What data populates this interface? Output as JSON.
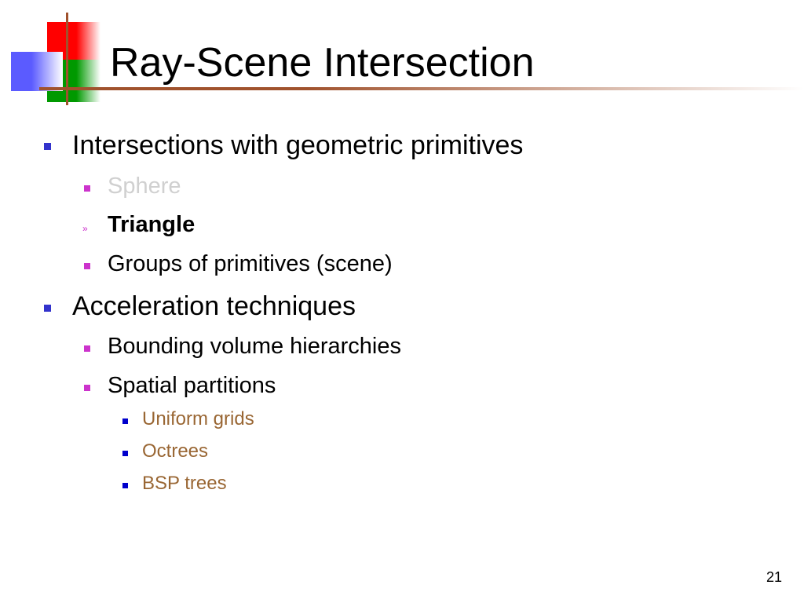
{
  "colors": {
    "red": "#ff0000",
    "green": "#009900",
    "blue": "#5b5bff",
    "rule": "#a0522d",
    "level1_bullet": "#3333cc",
    "level2_bullet": "#cc33cc",
    "level3_bullet": "#0000cc",
    "level3_text": "#996633",
    "dimmed_text": "#d0d0d0"
  },
  "slide": {
    "title": "Ray-Scene Intersection",
    "page_number": "21",
    "items": [
      {
        "level": 1,
        "text": "Intersections with geometric primitives",
        "bullet": "square"
      },
      {
        "level": 2,
        "text": "Sphere",
        "bullet": "square",
        "state": "dimmed"
      },
      {
        "level": 2,
        "text": "Triangle",
        "bullet": "guillemet",
        "state": "current"
      },
      {
        "level": 2,
        "text": "Groups of primitives (scene)",
        "bullet": "square"
      },
      {
        "level": 1,
        "text": "Acceleration techniques",
        "bullet": "square"
      },
      {
        "level": 2,
        "text": "Bounding volume hierarchies",
        "bullet": "square"
      },
      {
        "level": 2,
        "text": "Spatial partitions",
        "bullet": "square"
      },
      {
        "level": 3,
        "text": "Uniform grids",
        "bullet": "square"
      },
      {
        "level": 3,
        "text": "Octrees",
        "bullet": "square"
      },
      {
        "level": 3,
        "text": "BSP trees",
        "bullet": "square"
      }
    ]
  }
}
